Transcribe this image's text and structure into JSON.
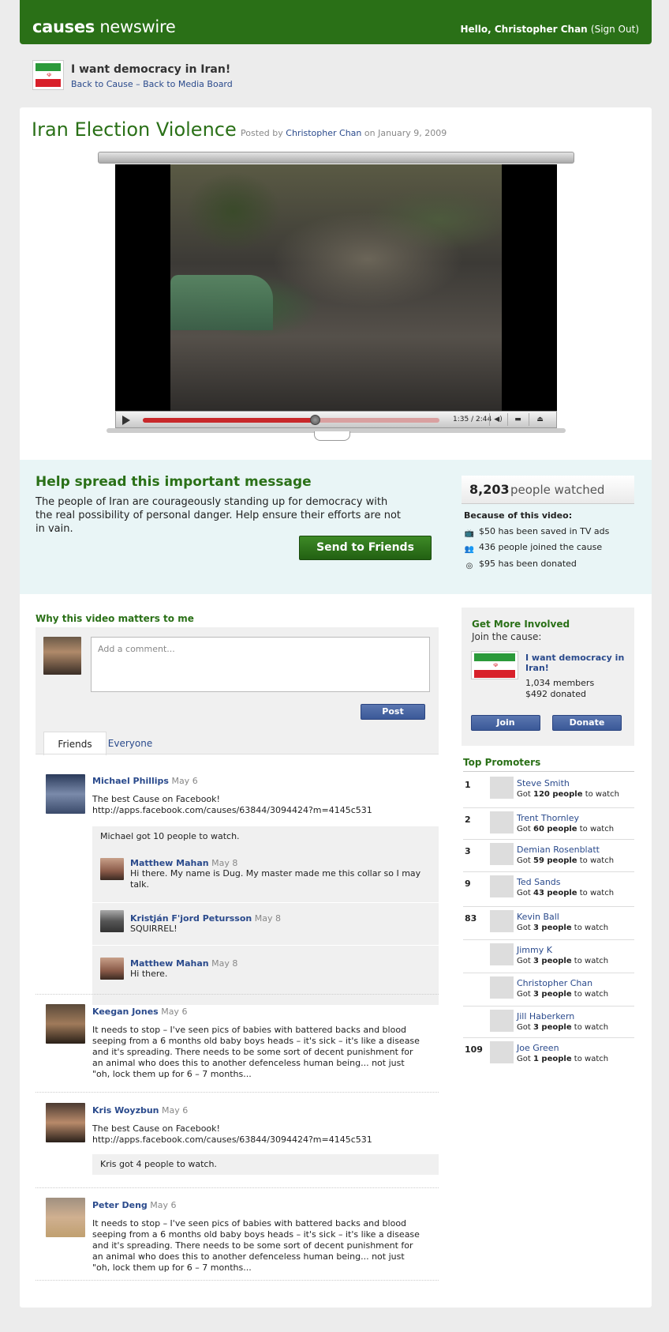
{
  "header": {
    "brand_bold": "causes",
    "brand_rest": " newswire",
    "greeting": "Hello, Christopher Chan",
    "signout": "(Sign Out)"
  },
  "cause": {
    "title": "I want democracy in Iran!",
    "back_cause": "Back to Cause",
    "sep": " – ",
    "back_media": "Back to Media Board"
  },
  "post": {
    "title": "Iran Election Violence",
    "posted_prefix": "Posted by",
    "author": "Christopher Chan",
    "date_prefix": "on January 9, 2009"
  },
  "video": {
    "time": "1:35 / 2:44",
    "progress": 0.58
  },
  "spread": {
    "heading": "Help spread this important message",
    "body": "The people of Iran are courageously standing up for democracy with the real possibility of personal danger. Help ensure their efforts are not in vain.",
    "send_label": "Send to Friends",
    "watched_count": "8,203",
    "watched_label": "people watched",
    "because": "Because of this video:",
    "stats": [
      "$50 has been saved in TV ads",
      "436 people joined the cause",
      "$95 has been donated"
    ]
  },
  "why": {
    "heading": "Why this video matters to me",
    "placeholder": "Add a comment...",
    "post_label": "Post",
    "tabs": [
      "Friends",
      "Everyone"
    ]
  },
  "comments": [
    {
      "name": "Michael Phillips",
      "date": "May 6",
      "text": "The best Cause on Facebook! http://apps.facebook.com/causes/63844/3094424?m=4145c531",
      "note": "Michael got 10 people to watch.",
      "replies": [
        {
          "name": "Matthew Mahan",
          "date": "May 8",
          "text": "Hi there. My name is Dug. My master made me this collar so I may talk."
        },
        {
          "name": "Kristján F'jord Petursson",
          "date": "May 8",
          "text": "SQUIRREL!"
        },
        {
          "name": "Matthew Mahan",
          "date": "May 8",
          "text": "Hi there."
        }
      ]
    },
    {
      "name": "Keegan Jones",
      "date": "May 6",
      "text": "It needs to stop – I've seen pics of babies with battered backs and blood seeping from a 6 months old baby boys heads – it's sick – it's like a disease and it's spreading. There needs to be some sort of decent punishment for an animal who does this to another defenceless human being... not just \"oh, lock them up for 6 – 7 months..."
    },
    {
      "name": "Kris Woyzbun",
      "date": "May 6",
      "text": "The best Cause on Facebook! http://apps.facebook.com/causes/63844/3094424?m=4145c531",
      "note": "Kris got 4 people to watch."
    },
    {
      "name": "Peter Deng",
      "date": "May 6",
      "text": "It needs to stop – I've seen pics of babies with battered backs and blood seeping from a 6 months old baby boys heads – it's sick – it's like a disease and it's spreading. There needs to be some sort of decent punishment for an animal who does this to another defenceless human being... not just \"oh, lock them up for 6 – 7 months..."
    }
  ],
  "involved": {
    "heading": "Get More Involved",
    "join_text": "Join the cause:",
    "cause_name": "I want democracy in Iran!",
    "members": "1,034 members",
    "donated": "$492 donated",
    "join_label": "Join",
    "donate_label": "Donate"
  },
  "promoters": {
    "heading": "Top Promoters",
    "rows": [
      {
        "rank": "1",
        "name": "Steve Smith",
        "pre": "Got",
        "count": "120 people",
        "post": "to watch"
      },
      {
        "rank": "2",
        "name": "Trent Thornley",
        "pre": "Got",
        "count": "60 people",
        "post": "to watch"
      },
      {
        "rank": "3",
        "name": "Demian Rosenblatt",
        "pre": "Got",
        "count": "59 people",
        "post": "to watch"
      },
      {
        "rank": "9",
        "name": "Ted Sands",
        "pre": "Got",
        "count": "43 people",
        "post": "to watch"
      },
      {
        "rank": "83",
        "name": "Kevin Ball",
        "pre": "Got",
        "count": "3 people",
        "post": "to watch"
      },
      {
        "rank": "",
        "name": "Jimmy K",
        "pre": "Got",
        "count": "3 people",
        "post": "to watch"
      },
      {
        "rank": "",
        "name": "Christopher Chan",
        "pre": "Got",
        "count": "3 people",
        "post": "to watch"
      },
      {
        "rank": "",
        "name": "Jill Haberkern",
        "pre": "Got",
        "count": "3 people",
        "post": "to watch"
      },
      {
        "rank": "109",
        "name": "Joe Green",
        "pre": "Got",
        "count": "1 people",
        "post": "to watch"
      }
    ]
  },
  "colors": {
    "brand_green": "#2a7017",
    "link_blue": "#2a4a8c",
    "button_blue": "#3b5998",
    "panel_bg": "#e9f5f6"
  }
}
